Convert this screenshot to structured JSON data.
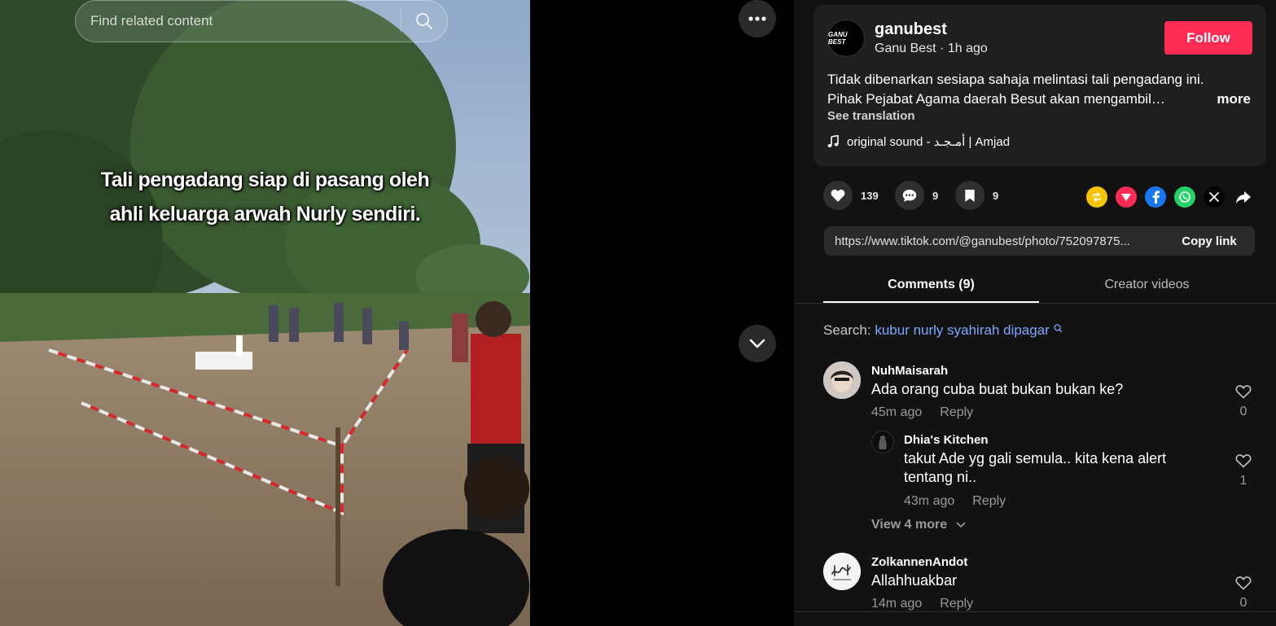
{
  "search": {
    "placeholder": "Find related content"
  },
  "photo": {
    "caption_line1": "Tali pengadang siap di pasang oleh",
    "caption_line2": "ahli keluarga arwah Nurly sendiri."
  },
  "post": {
    "avatar_text": "GANU BEST",
    "username": "ganubest",
    "display_name": "Ganu Best",
    "time": "1h ago",
    "subline": "Ganu Best · 1h ago",
    "follow_label": "Follow",
    "description_line1": "Tidak dibenarkan sesiapa sahaja melintasi tali pengadang ini.",
    "description_line2": "Pihak Pejabat Agama daerah Besut akan mengambil…",
    "more_label": "more",
    "see_translation": "See translation",
    "sound": "original sound - أمـجـد | Amjad"
  },
  "actions": {
    "likes": "139",
    "comments": "9",
    "saves": "9"
  },
  "share_colors": {
    "repost": "#f7c600",
    "send": "#fe2c55",
    "facebook": "#1877f2",
    "whatsapp": "#25d366",
    "x": "#000000"
  },
  "link": {
    "url": "https://www.tiktok.com/@ganubest/photo/752097875...",
    "copy_label": "Copy link"
  },
  "tabs": {
    "comments": "Comments (9)",
    "creator": "Creator videos"
  },
  "search_hint": {
    "prefix": "Search:",
    "query": "kubur nurly syahirah dipagar"
  },
  "comments": [
    {
      "user": "NuhMaisarah",
      "text": "Ada orang cuba buat bukan bukan ke?",
      "time": "45m ago",
      "reply": "Reply",
      "likes": "0"
    },
    {
      "user": "Dhia's Kitchen",
      "text_line1": "takut Ade yg gali semula.. kita kena alert",
      "text_line2": "tentang ni..",
      "time": "43m ago",
      "reply": "Reply",
      "likes": "1"
    },
    {
      "user": "ZolkannenAndot",
      "text": "Allahhuakbar",
      "time": "14m ago",
      "reply": "Reply",
      "likes": "0"
    }
  ],
  "view_more": "View 4 more"
}
